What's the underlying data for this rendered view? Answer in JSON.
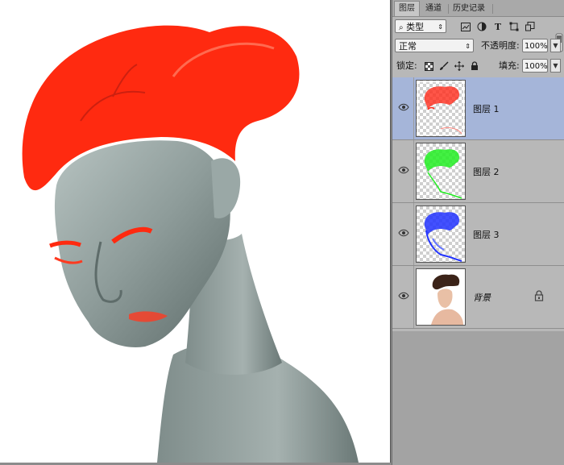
{
  "tabs": [
    {
      "label": "图层",
      "active": true
    },
    {
      "label": "通道",
      "active": false
    },
    {
      "label": "历史记录",
      "active": false
    }
  ],
  "filter": {
    "kind_label": "类型",
    "icons": [
      "image-filter-icon",
      "adjustment-filter-icon",
      "type-filter-icon",
      "shape-filter-icon",
      "smart-object-filter-icon"
    ]
  },
  "blend": {
    "mode": "正常",
    "opacity_label": "不透明度:",
    "opacity_value": "100%"
  },
  "lock": {
    "label": "锁定:",
    "fill_label": "填充:",
    "fill_value": "100%",
    "icons": [
      "lock-transparent-icon",
      "lock-paint-icon",
      "lock-position-icon",
      "lock-all-icon"
    ]
  },
  "layers": [
    {
      "name": "图层 1",
      "selected": true,
      "tint": "#ff2a1a"
    },
    {
      "name": "图层 2",
      "selected": false,
      "tint": "#22ee22"
    },
    {
      "name": "图层 3",
      "selected": false,
      "tint": "#2233ff"
    },
    {
      "name": "背景",
      "selected": false,
      "locked": true,
      "background": true
    }
  ],
  "colors": {
    "selection": "#a5b5d9",
    "panel": "#b8b8b8",
    "hair": "#ff2a10",
    "skin": "#8a9896"
  }
}
